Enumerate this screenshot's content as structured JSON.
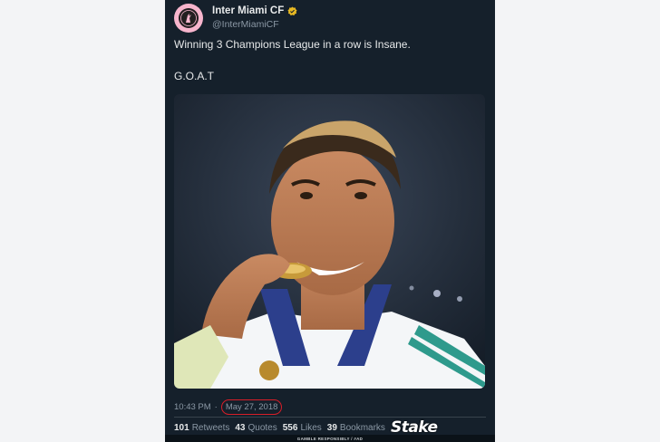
{
  "account": {
    "display_name": "Inter Miami CF",
    "handle": "@InterMiamiCF",
    "avatar_icon": "heron-crest-icon",
    "verified_icon": "verified-badge-icon"
  },
  "tweet": {
    "text_line1": "Winning 3 Champions League in a row is Insane.",
    "text_line2": "G.O.A.T",
    "time": "10:43 PM",
    "separator": "·",
    "date": "May 27, 2018"
  },
  "stats": {
    "retweets_count": "101",
    "retweets_label": "Retweets",
    "quotes_count": "43",
    "quotes_label": "Quotes",
    "likes_count": "556",
    "likes_label": "Likes",
    "bookmarks_count": "39",
    "bookmarks_label": "Bookmarks"
  },
  "overlay": {
    "brand_logo": "Stake",
    "disclaimer": "GAMBLE RESPONSIBLY  /  #AD"
  },
  "colors": {
    "tweet_bg": "#15202b",
    "page_bg": "#f3f4f6",
    "avatar_bg": "#f7b5cd",
    "verified": "#e8b923",
    "highlight_circle": "#d81e28"
  }
}
